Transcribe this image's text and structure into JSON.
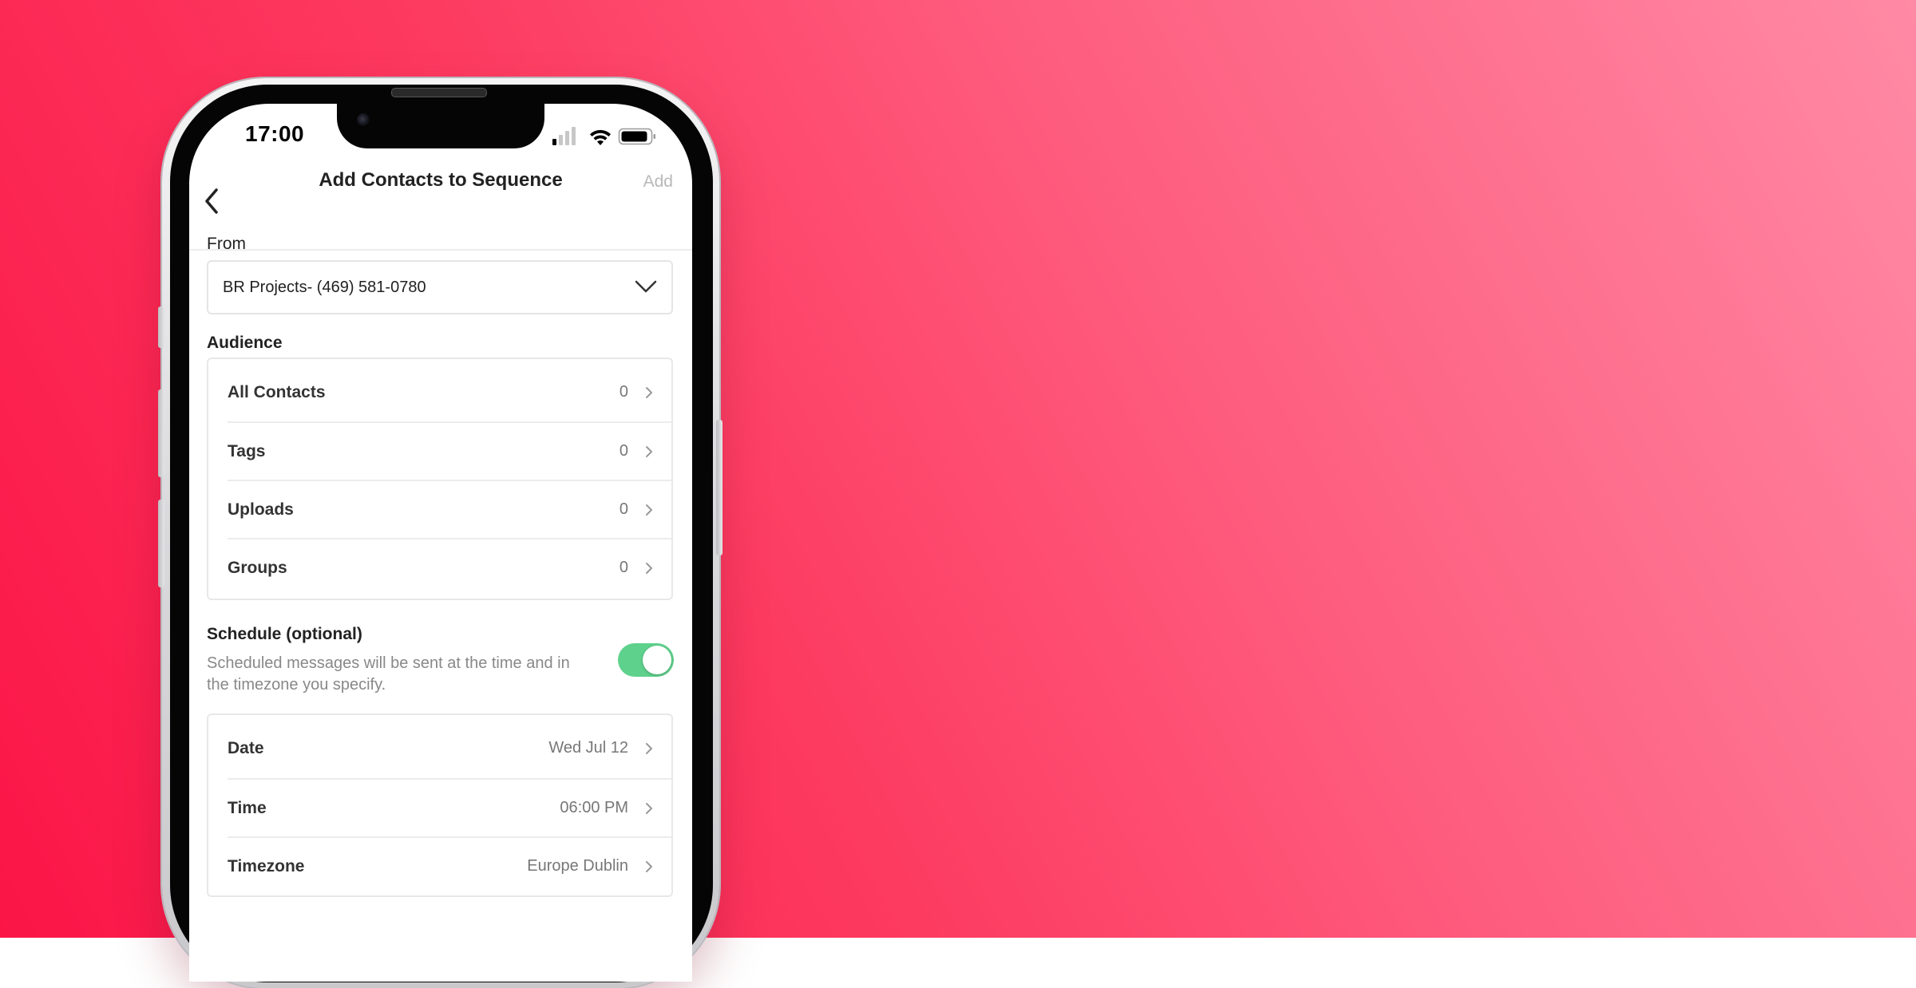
{
  "status_bar": {
    "time": "17:00"
  },
  "nav": {
    "title": "Add Contacts to Sequence",
    "add_label": "Add"
  },
  "from": {
    "label": "From",
    "value": "BR Projects- (469) 581-0780"
  },
  "audience": {
    "label": "Audience",
    "rows": [
      {
        "label": "All Contacts",
        "value": "0"
      },
      {
        "label": "Tags",
        "value": "0"
      },
      {
        "label": "Uploads",
        "value": "0"
      },
      {
        "label": "Groups",
        "value": "0"
      }
    ]
  },
  "schedule": {
    "label": "Schedule (optional)",
    "description": "Scheduled messages will be sent at the time and in the timezone you specify.",
    "enabled": true,
    "rows": [
      {
        "label": "Date",
        "value": "Wed Jul 12"
      },
      {
        "label": "Time",
        "value": "06:00 PM"
      },
      {
        "label": "Timezone",
        "value": "Europe Dublin"
      }
    ]
  },
  "colors": {
    "background_start": "#fb1547",
    "background_end": "#ff8aa5",
    "toggle_on": "#5ed18c",
    "disabled_text": "#b8b8b8"
  }
}
